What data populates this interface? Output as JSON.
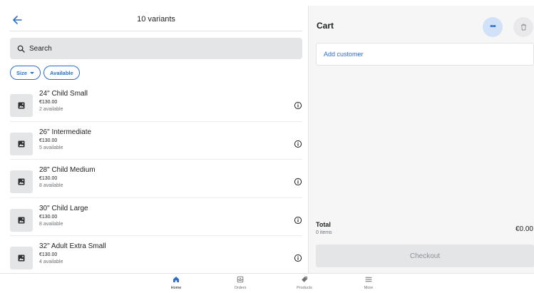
{
  "header": {
    "title": "10 variants"
  },
  "search": {
    "placeholder": "Search"
  },
  "filters": [
    {
      "label": "Size",
      "has_dropdown": true
    },
    {
      "label": "Available",
      "has_dropdown": false
    }
  ],
  "variants": [
    {
      "name": "24\" Child Small",
      "price": "€130.00",
      "availability": "2 available"
    },
    {
      "name": "26\" Intermediate",
      "price": "€130.00",
      "availability": "5 available"
    },
    {
      "name": "28\" Child Medium",
      "price": "€130.00",
      "availability": "8 available"
    },
    {
      "name": "30\" Child Large",
      "price": "€130.00",
      "availability": "8 available"
    },
    {
      "name": "32\" Adult Extra Small",
      "price": "€130.00",
      "availability": "4 available"
    }
  ],
  "cart": {
    "title": "Cart",
    "add_customer_label": "Add customer",
    "total_label": "Total",
    "items_count": "0 items",
    "total_value": "€0.00",
    "checkout_label": "Checkout"
  },
  "nav": [
    {
      "label": "Home",
      "icon": "home-icon",
      "active": true
    },
    {
      "label": "Orders",
      "icon": "orders-icon",
      "active": false
    },
    {
      "label": "Products",
      "icon": "tag-icon",
      "active": false
    },
    {
      "label": "More",
      "icon": "menu-icon",
      "active": false
    }
  ],
  "colors": {
    "accent": "#2c6ecb",
    "accent_light": "#d0e1f8",
    "panel_bg": "#f6f6f7",
    "disabled_bg": "#e4e5e7",
    "text": "#202223",
    "subdued": "#6d7175"
  }
}
